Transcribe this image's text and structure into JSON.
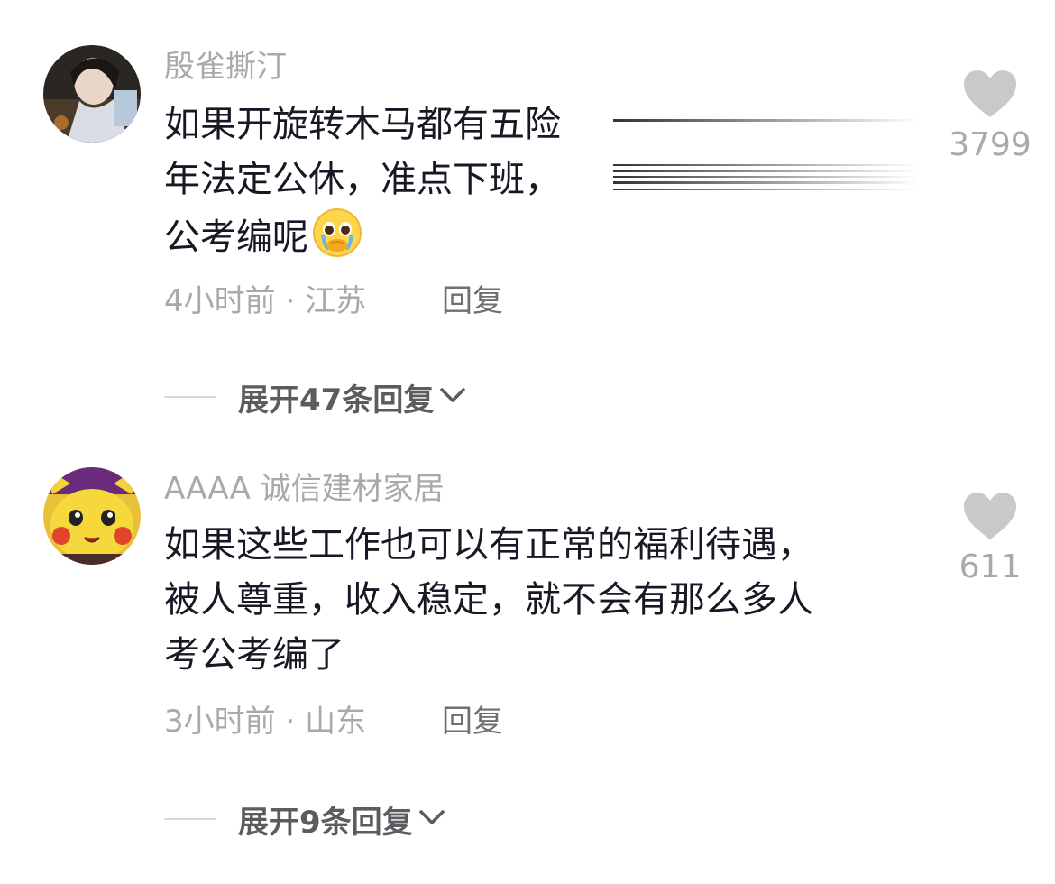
{
  "comments": [
    {
      "username": "殷雀撕汀",
      "lines": [
        "如果开旋转木马都有五险",
        "年法定公休，准点下班，",
        "公考编呢"
      ],
      "time": "4小时前",
      "separator": "·",
      "location": "江苏",
      "reply_label": "回复",
      "likes": "3799",
      "expand_label": "展开47条回复",
      "avatar_icon": "user-avatar-photo",
      "emoji_icon": "crying-face-emoji"
    },
    {
      "username": "AAAA 诚信建材家居",
      "lines": [
        "如果这些工作也可以有正常的福利待遇，",
        "被人尊重，收入稳定，就不会有那么多人",
        "考公考编了"
      ],
      "time": "3小时前",
      "separator": "·",
      "location": "山东",
      "reply_label": "回复",
      "likes": "611",
      "expand_label": "展开9条回复",
      "avatar_icon": "pikachu-avatar"
    }
  ],
  "colors": {
    "text": "#161823",
    "muted": "#a9a9ad",
    "reply": "#6e6e73",
    "heart": "#c9c9cc"
  }
}
